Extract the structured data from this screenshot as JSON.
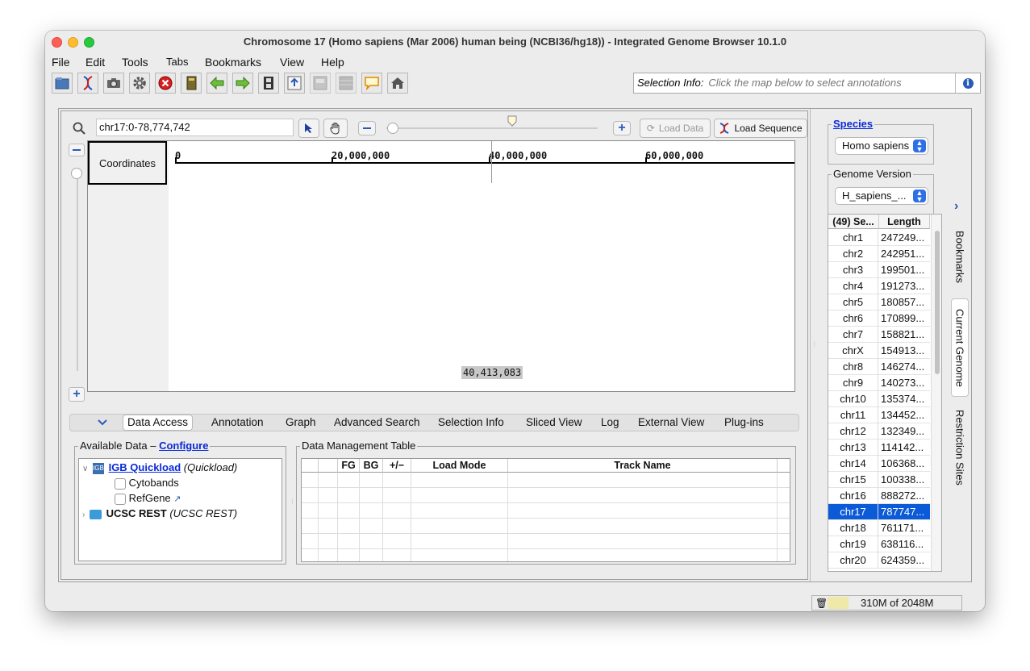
{
  "window": {
    "title": "Chromosome 17  (Homo sapiens (Mar 2006) human being (NCBI36/hg18)) - Integrated Genome Browser 10.1.0"
  },
  "menu": [
    "File",
    "Edit",
    "Tools",
    "Tabs",
    "Bookmarks",
    "View",
    "Help"
  ],
  "toolbar": {
    "icons": [
      "open-folder-icon",
      "dna-icon",
      "camera-icon",
      "gear-icon",
      "stop-icon",
      "book-icon",
      "back-arrow-icon",
      "forward-arrow-icon",
      "film-icon",
      "upload-icon",
      "panel-icon",
      "grid-icon",
      "speech-bubble-icon",
      "home-icon"
    ]
  },
  "selection_info": {
    "label": "Selection Info:",
    "placeholder": "Click the map below to select annotations"
  },
  "location": {
    "value": "chr17:0-78,774,742"
  },
  "buttons": {
    "load_data": "Load Data",
    "load_sequence": "Load Sequence"
  },
  "main_view": {
    "coordinates_label": "Coordinates",
    "ruler_ticks": [
      "0",
      "20,000,000",
      "40,000,000",
      "60,000,000"
    ],
    "position_readout": "40,413,083"
  },
  "bottom_tabs": [
    "Data Access",
    "Annotation",
    "Graph",
    "Advanced Search",
    "Selection Info",
    "Sliced View",
    "Log",
    "External View",
    "Plug-ins"
  ],
  "available_data": {
    "title": "Available Data",
    "dash": " – ",
    "configure_link": "Configure",
    "quickload_name": "IGB Quickload",
    "quickload_type": "(Quickload)",
    "items": [
      "Cytobands",
      "RefGene"
    ],
    "ucsc_name": "UCSC REST",
    "ucsc_type": "(UCSC REST)"
  },
  "data_management": {
    "title": "Data Management Table",
    "columns": [
      "",
      "",
      "FG",
      "BG",
      "+/−",
      "Load Mode",
      "Track Name",
      ""
    ]
  },
  "side_panel": {
    "species_label": "Species",
    "species_value": "Homo sapiens",
    "genome_version_label": "Genome Version",
    "genome_version_value": "H_sapiens_...",
    "table_headers": [
      "(49) Se...",
      "Length"
    ],
    "chromosomes": [
      {
        "name": "chr1",
        "length": "247249..."
      },
      {
        "name": "chr2",
        "length": "242951..."
      },
      {
        "name": "chr3",
        "length": "199501..."
      },
      {
        "name": "chr4",
        "length": "191273..."
      },
      {
        "name": "chr5",
        "length": "180857..."
      },
      {
        "name": "chr6",
        "length": "170899..."
      },
      {
        "name": "chr7",
        "length": "158821..."
      },
      {
        "name": "chrX",
        "length": "154913..."
      },
      {
        "name": "chr8",
        "length": "146274..."
      },
      {
        "name": "chr9",
        "length": "140273..."
      },
      {
        "name": "chr10",
        "length": "135374..."
      },
      {
        "name": "chr11",
        "length": "134452..."
      },
      {
        "name": "chr12",
        "length": "132349..."
      },
      {
        "name": "chr13",
        "length": "114142..."
      },
      {
        "name": "chr14",
        "length": "106368..."
      },
      {
        "name": "chr15",
        "length": "100338..."
      },
      {
        "name": "chr16",
        "length": "888272..."
      },
      {
        "name": "chr17",
        "length": "787747..."
      },
      {
        "name": "chr18",
        "length": "761171..."
      },
      {
        "name": "chr19",
        "length": "638116..."
      },
      {
        "name": "chr20",
        "length": "624359..."
      }
    ],
    "selected_chromosome": "chr17",
    "vertical_tabs": [
      "Bookmarks",
      "Current Genome",
      "Restriction Sites"
    ]
  },
  "status": {
    "memory": "310M of 2048M"
  },
  "colors": {
    "selection": "#0b5ad8",
    "link": "#0a2ad6"
  }
}
